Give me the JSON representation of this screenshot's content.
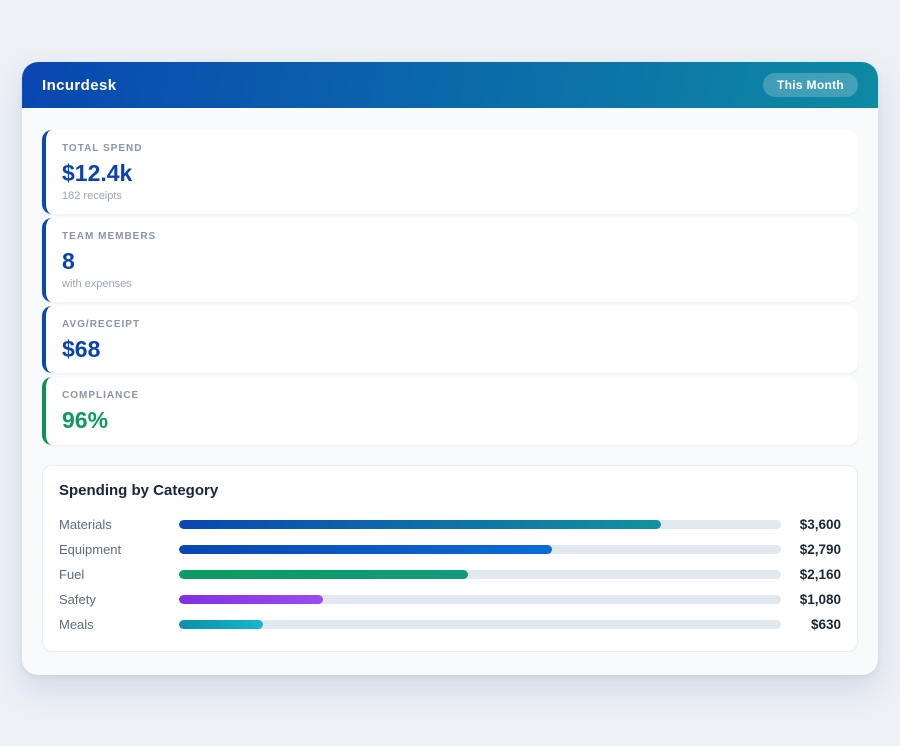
{
  "app": {
    "title": "Incurdesk",
    "period_badge": "This Month"
  },
  "theme": {
    "header_gradient_start": "#0947b2",
    "header_gradient_end": "#0d8aa3",
    "page_background": "#edf1f6",
    "panel_background": "#f9fafc",
    "card_background": "#ffffff",
    "stat_accent_blue": "#0947b2",
    "stat_accent_green": "#0d9157",
    "track_color": "#e2e8f0"
  },
  "stats": [
    {
      "label": "TOTAL SPEND",
      "value": "$12.4k",
      "sub": "182 receipts",
      "accent_color": "#0947b2",
      "value_color": "#0a43ae"
    },
    {
      "label": "TEAM MEMBERS",
      "value": "8",
      "sub": "with expenses",
      "accent_color": "#0947b2",
      "value_color": "#0a43ae"
    },
    {
      "label": "AVG/RECEIPT",
      "value": "$68",
      "sub": "",
      "accent_color": "#0947b2",
      "value_color": "#0a43ae"
    },
    {
      "label": "COMPLIANCE",
      "value": "96%",
      "sub": "",
      "accent_color": "#0d9157",
      "value_color": "#0f9960"
    }
  ],
  "chart_data": {
    "type": "bar",
    "orientation": "horizontal",
    "title": "Spending by Category",
    "categories": [
      "Materials",
      "Equipment",
      "Fuel",
      "Safety",
      "Meals"
    ],
    "values": [
      3600,
      2790,
      2160,
      1080,
      630
    ],
    "value_labels": [
      "$3,600",
      "$2,790",
      "$2,160",
      "$1,080",
      "$630"
    ],
    "xlim": [
      0,
      4500
    ],
    "grid": false,
    "legend": false,
    "bar_gradients": [
      [
        "#0947b2",
        "#13929e"
      ],
      [
        "#0947b2",
        "#0b6cd6"
      ],
      [
        "#0c9b60",
        "#139a7c"
      ],
      [
        "#8030e0",
        "#9d4cf0"
      ],
      [
        "#0d8fa6",
        "#14b8cd"
      ]
    ]
  }
}
